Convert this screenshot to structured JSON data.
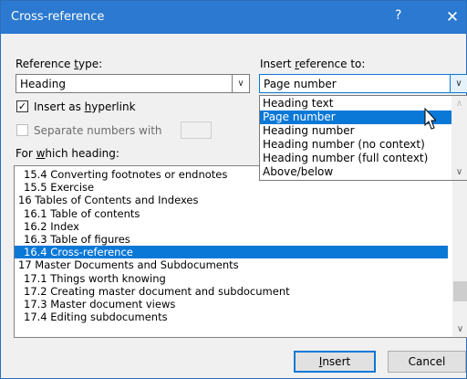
{
  "window": {
    "title": "Cross-reference",
    "help_glyph": "?",
    "close_glyph": "✕"
  },
  "reference_type": {
    "label_pre": "Reference ",
    "label_u": "t",
    "label_post": "ype:",
    "value": "Heading"
  },
  "insert_reference_to": {
    "label_pre": "Insert ",
    "label_u": "r",
    "label_post": "eference to:",
    "value": "Page number",
    "options": [
      "Heading text",
      "Page number",
      "Heading number",
      "Heading number (no context)",
      "Heading number (full  context)",
      "Above/below"
    ],
    "selected_index": 1
  },
  "insert_as_hyperlink": {
    "label_pre": "Insert as ",
    "label_u": "h",
    "label_post": "yperlink",
    "checked": true,
    "check_glyph": "✓"
  },
  "separate_numbers": {
    "label": "Separate numbers with",
    "checked": false
  },
  "for_which_heading": {
    "label_pre": "For ",
    "label_u": "w",
    "label_post": "hich heading:",
    "items": [
      "15.4 Converting footnotes or endnotes",
      "15.5 Exercise",
      "16 Tables of Contents and Indexes",
      "16.1 Table of contents",
      "16.2 Index",
      "16.3 Table of figures",
      "16.4 Cross-reference",
      "17 Master Documents and Subdocuments",
      "17.1 Things worth knowing",
      "17.2 Creating master document and subdocument",
      "17.3 Master document views",
      "17.4 Editing subdocuments"
    ],
    "indent": [
      true,
      true,
      false,
      true,
      true,
      true,
      true,
      false,
      true,
      true,
      true,
      true
    ],
    "selected_index": 6
  },
  "buttons": {
    "insert_u": "I",
    "insert_rest": "nsert",
    "cancel": "Cancel"
  },
  "colors": {
    "titlebar": "#2b79d0",
    "selection": "#0a78d7"
  }
}
